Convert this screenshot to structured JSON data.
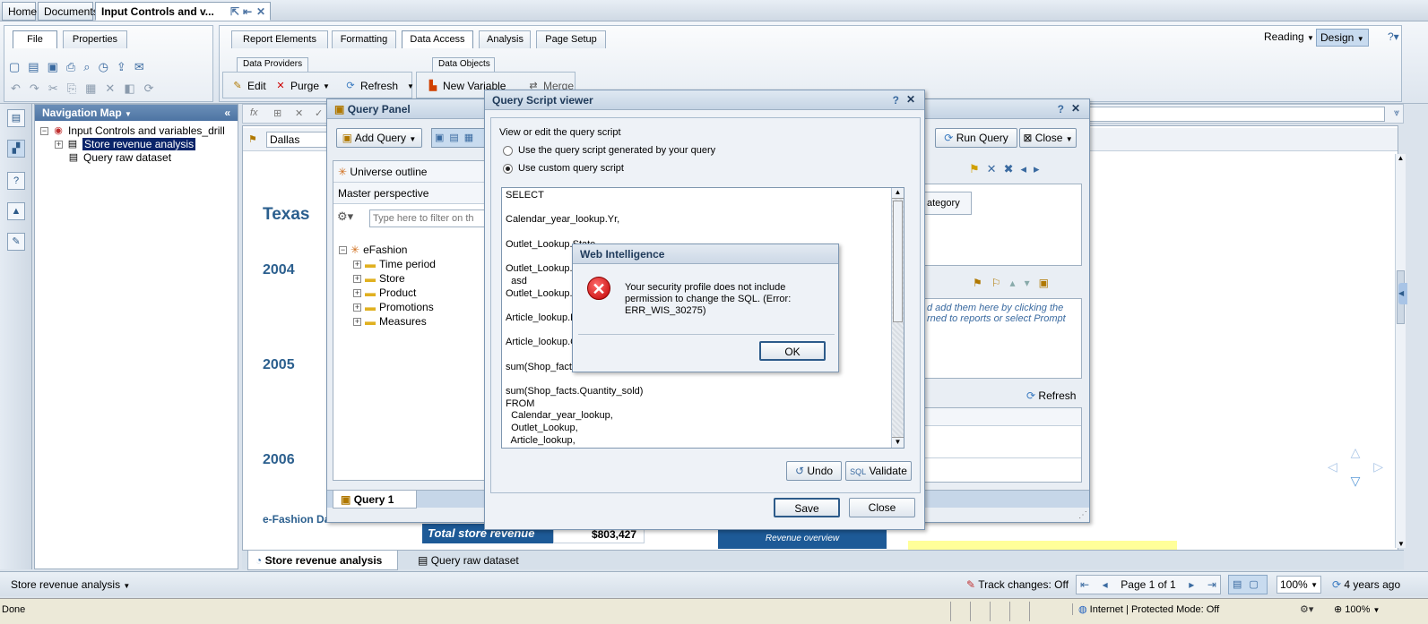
{
  "top_tabs": {
    "home": "Home",
    "documents": "Documents",
    "active_doc": "Input Controls and v..."
  },
  "ribbon": {
    "file": "File",
    "properties": "Properties",
    "tabs": [
      "Report Elements",
      "Formatting",
      "Data Access",
      "Analysis",
      "Page Setup"
    ],
    "subtabs": {
      "providers": "Data Providers",
      "objects": "Data Objects"
    },
    "buttons": {
      "edit": "Edit",
      "purge": "Purge",
      "refresh": "Refresh",
      "new_variable": "New Variable",
      "merge": "Merge"
    },
    "mode_reading": "Reading",
    "mode_design": "Design"
  },
  "nav": {
    "header": "Navigation Map",
    "root": "Input Controls and variables_drill",
    "items": [
      "Store revenue analysis",
      "Query raw dataset"
    ]
  },
  "report": {
    "filter_value": "Dallas",
    "state": "Texas",
    "years": [
      "2004",
      "2005",
      "2006"
    ],
    "footer_label": "e-Fashion Da",
    "total_label": "Total store revenue",
    "total_value": "$803,427",
    "overview": "Revenue overview"
  },
  "query_panel": {
    "title": "Query Panel",
    "add_query": "Add Query",
    "run_query": "Run Query",
    "close": "Close",
    "outline": "Universe outline",
    "perspective": "Master perspective",
    "filter_placeholder": "Type here to filter on th",
    "universe": "eFashion",
    "folders": [
      "Time period",
      "Store",
      "Product",
      "Promotions",
      "Measures"
    ],
    "category": "ategory",
    "prompt_hint_1": "d add them here by clicking the",
    "prompt_hint_2": "rned to reports or select Prompt",
    "refresh": "Refresh",
    "query_tab": "Query 1"
  },
  "script_viewer": {
    "title": "Query Script viewer",
    "instruction": "View or edit the query script",
    "option_generated": "Use the query script generated by your query",
    "option_custom": "Use custom query script",
    "sql_lines": [
      "SELECT",
      "",
      "Calendar_year_lookup.Yr,",
      "",
      "Outlet_Lookup.State,",
      "",
      "Outlet_Lookup.C",
      "  asd",
      "Outlet_Lookup.S",
      "",
      "Article_lookup.F",
      "",
      "Article_lookup.C",
      "",
      "sum(Shop_facts",
      "",
      "sum(Shop_facts.Quantity_sold)",
      "FROM",
      "  Calendar_year_lookup,",
      "  Outlet_Lookup,",
      "  Article_lookup,"
    ],
    "undo": "Undo",
    "validate": "Validate",
    "save": "Save",
    "close": "Close"
  },
  "error_dialog": {
    "title": "Web Intelligence",
    "message": "Your security profile does not include permission to change the SQL. (Error: ERR_WIS_30275)",
    "ok": "OK"
  },
  "report_tabs": [
    "Store revenue analysis",
    "Query raw dataset"
  ],
  "bottom": {
    "report_select": "Store revenue analysis",
    "track_changes": "Track changes: Off",
    "page": "Page 1 of 1",
    "zoom": "100%",
    "updated": "4 years ago"
  },
  "statusbar": {
    "left": "Done",
    "zone": "Internet | Protected Mode: Off",
    "zoom": "100%"
  }
}
